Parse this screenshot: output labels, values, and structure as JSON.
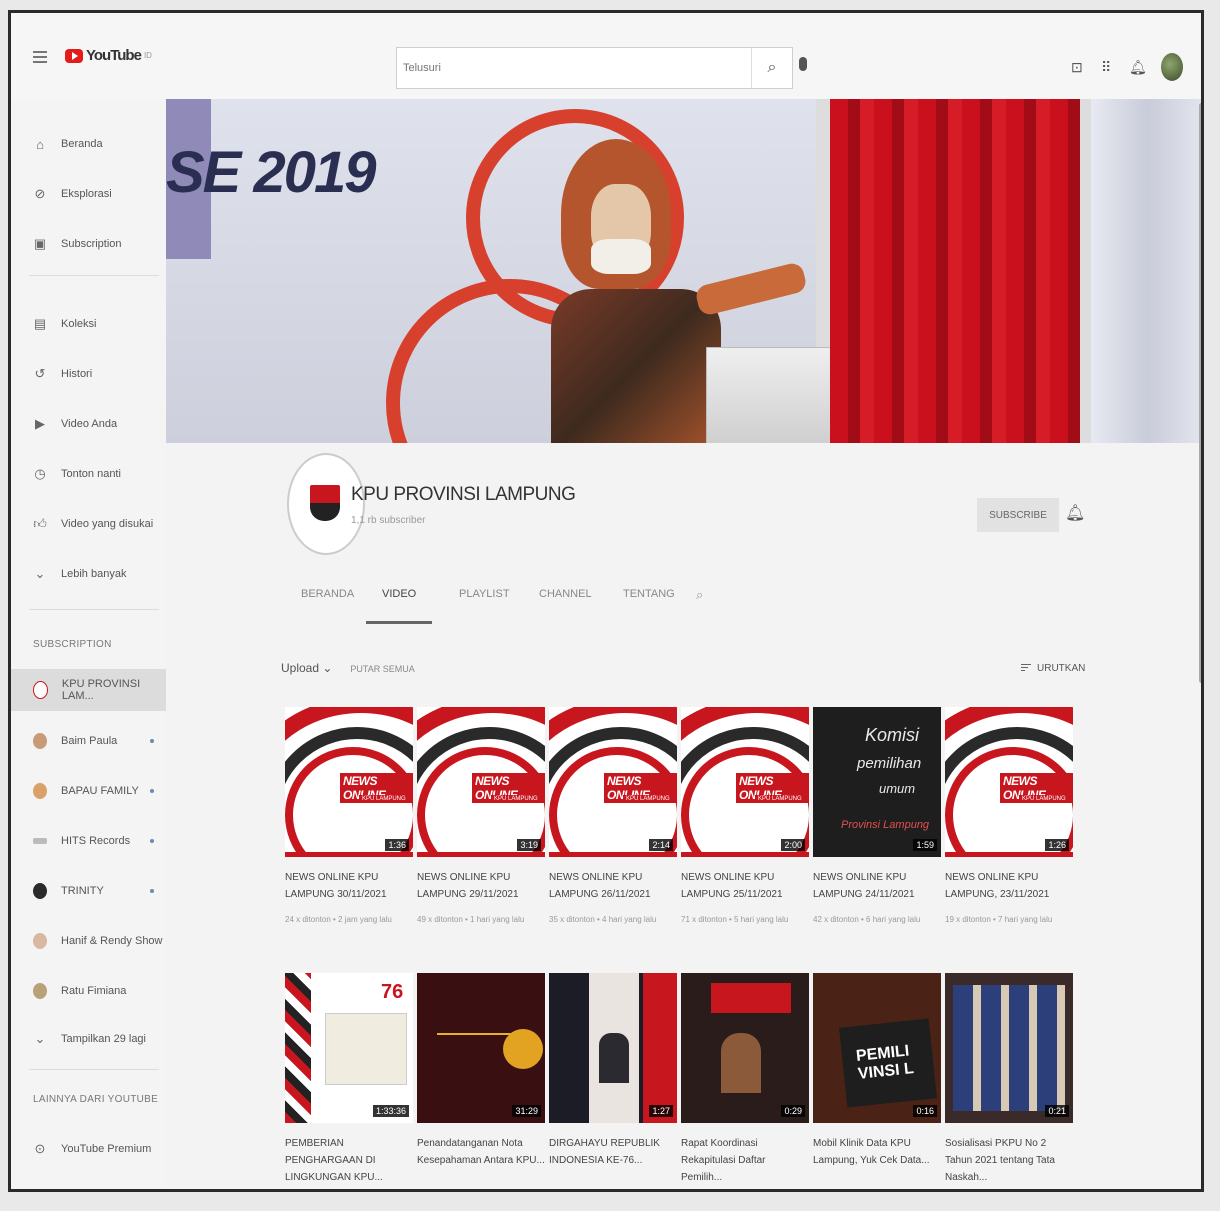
{
  "search": {
    "placeholder": "Telusuri"
  },
  "sidebar": {
    "main": [
      {
        "label": "Beranda",
        "icon": "home-icon"
      },
      {
        "label": "Eksplorasi",
        "icon": "compass-icon"
      },
      {
        "label": "Subscription",
        "icon": "subscriptions-icon"
      }
    ],
    "library": [
      {
        "label": "Koleksi",
        "icon": "library-icon"
      },
      {
        "label": "Histori",
        "icon": "history-icon"
      },
      {
        "label": "Video Anda",
        "icon": "your-videos-icon"
      },
      {
        "label": "Tonton nanti",
        "icon": "watch-later-icon"
      },
      {
        "label": "Video yang disukai",
        "icon": "thumbs-up-icon"
      },
      {
        "label": "Lebih banyak",
        "icon": "chevron-down-icon"
      }
    ],
    "subscription_heading": "SUBSCRIPTION",
    "subscriptions": [
      {
        "label": "KPU PROVINSI LAM..."
      },
      {
        "label": "Baim Paula"
      },
      {
        "label": "BAPAU FAMILY"
      },
      {
        "label": "HITS Records"
      },
      {
        "label": "TRINITY"
      },
      {
        "label": "Hanif & Rendy Show"
      },
      {
        "label": "Ratu Fimiana"
      }
    ],
    "show_more": "Tampilkan 29 lagi",
    "more_heading": "LAINNYA DARI YOUTUBE",
    "more": [
      {
        "label": "YouTube Premium"
      }
    ]
  },
  "banner": {
    "year_text": "SE 2019"
  },
  "channel": {
    "name": "KPU PROVINSI LAMPUNG",
    "subscribers": "1,1 rb subscriber",
    "subscribe_label": "SUBSCRIBE"
  },
  "tabs": [
    "BERANDA",
    "VIDEO",
    "PLAYLIST",
    "CHANNEL",
    "TENTANG"
  ],
  "active_tab": "VIDEO",
  "uploads": {
    "label": "Upload ⌄",
    "play_all": "PUTAR SEMUA",
    "sort": "URUTKAN"
  },
  "videos_row1": [
    {
      "title": "NEWS ONLINE KPU LAMPUNG 30/11/2021",
      "duration": "1:36",
      "meta": "24 x ditonton • 2 jam yang lalu"
    },
    {
      "title": "NEWS ONLINE KPU LAMPUNG 29/11/2021",
      "duration": "3:19",
      "meta": "49 x ditonton • 1 hari yang lalu"
    },
    {
      "title": "NEWS ONLINE KPU LAMPUNG 26/11/2021",
      "duration": "2:14",
      "meta": "35 x ditonton • 4 hari yang lalu"
    },
    {
      "title": "NEWS ONLINE KPU LAMPUNG 25/11/2021",
      "duration": "2:00",
      "meta": "71 x ditonton • 5 hari yang lalu"
    },
    {
      "title": "NEWS ONLINE KPU LAMPUNG 24/11/2021",
      "duration": "1:59",
      "meta": "42 x ditonton • 6 hari yang lalu"
    },
    {
      "title": "NEWS ONLINE KPU LAMPUNG, 23/11/2021",
      "duration": "1:26",
      "meta": "19 x ditonton • 7 hari yang lalu"
    }
  ],
  "videos_row2": [
    {
      "title": "PEMBERIAN PENGHARGAAN DI LINGKUNGAN KPU...",
      "duration": "1:33:36"
    },
    {
      "title": "Penandatanganan Nota Kesepahaman Antara KPU...",
      "duration": "31:29"
    },
    {
      "title": "DIRGAHAYU REPUBLIK INDONESIA KE-76...",
      "duration": "1:27"
    },
    {
      "title": "Rapat Koordinasi Rekapitulasi Daftar Pemilih...",
      "duration": "0:29"
    },
    {
      "title": "Mobil Klinik Data KPU Lampung, Yuk Cek Data...",
      "duration": "0:16"
    },
    {
      "title": "Sosialisasi PKPU No 2 Tahun 2021 tentang Tata Naskah...",
      "duration": "0:21"
    }
  ],
  "thumb_text": {
    "news": "NEWS ONLINE",
    "news_sub": "KPU LAMPUNG",
    "komisi_1": "Komisi",
    "komisi_2": "pemilihan",
    "komisi_3": "umum",
    "komisi_4": "Provinsi Lampung"
  },
  "colors": {
    "brand_red": "#c8161e",
    "youtube_red": "#e21b1b"
  }
}
